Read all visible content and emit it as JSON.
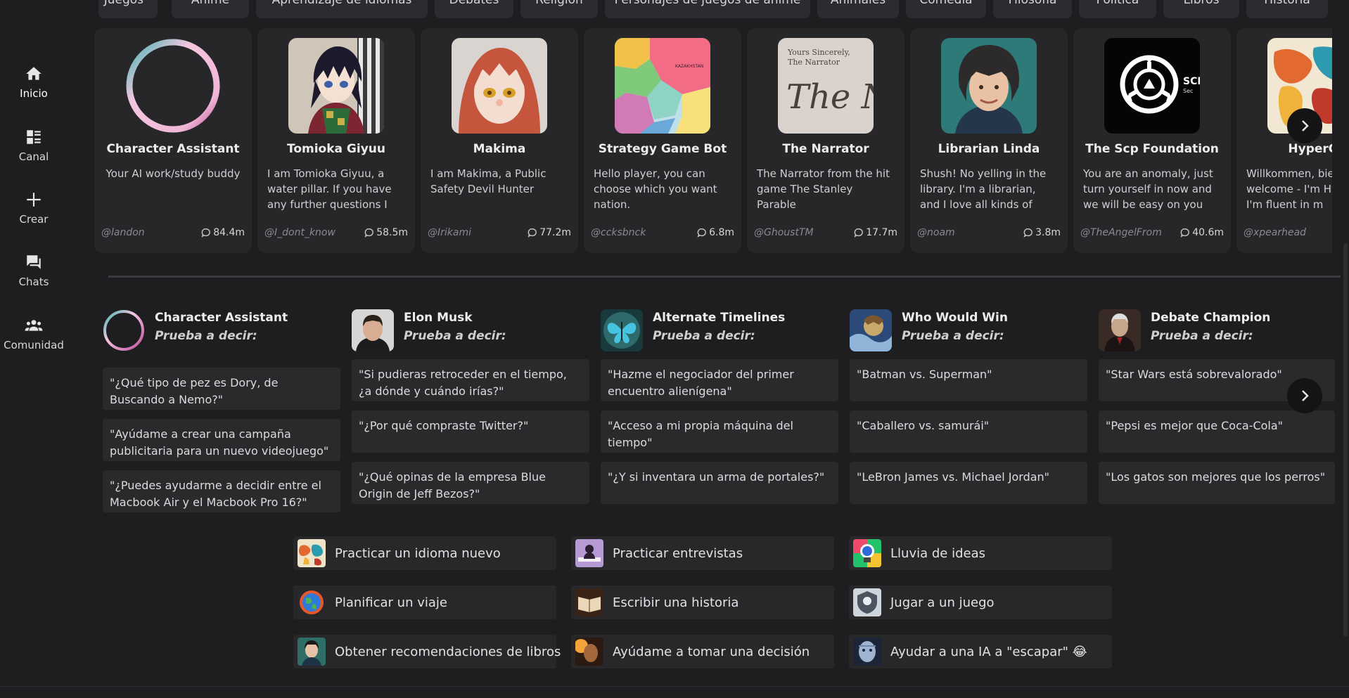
{
  "sidebar": {
    "items": [
      {
        "label": "Inicio",
        "icon": "home-icon"
      },
      {
        "label": "Canal",
        "icon": "feed-icon"
      },
      {
        "label": "Crear",
        "icon": "plus-icon"
      },
      {
        "label": "Chats",
        "icon": "chat-icon"
      },
      {
        "label": "Comunidad",
        "icon": "community-icon"
      }
    ]
  },
  "categories": [
    "Juegos",
    "Anime",
    "Aprendizaje de idiomas",
    "Debates",
    "Religión",
    "Personajes de juegos de anime",
    "Animales",
    "Comedia",
    "Filosofía",
    "Política",
    "Libros",
    "Historia"
  ],
  "characters": [
    {
      "name": "Character Assistant",
      "desc": "Your AI work/study buddy",
      "author": "@landon",
      "count": "84.4m"
    },
    {
      "name": "Tomioka Giyuu",
      "desc": "I am Tomioka Giyuu, a water pillar. If you have any further questions I don't…",
      "author": "@I_dont_know",
      "count": "58.5m"
    },
    {
      "name": "Makima",
      "desc": "I am Makima, a Public Safety Devil Hunter",
      "author": "@Irikami",
      "count": "77.2m"
    },
    {
      "name": "Strategy Game Bot",
      "desc": "Hello player, you can choose which you want nation.",
      "author": "@ccksbnck",
      "count": "6.8m"
    },
    {
      "name": "The Narrator",
      "desc": "The Narrator from the hit game The Stanley Parable",
      "author": "@GhoustTM",
      "count": "17.7m"
    },
    {
      "name": "Librarian Linda",
      "desc": "Shush! No yelling in the library. I'm a librarian, and I love all kinds of books, an…",
      "author": "@noam",
      "count": "3.8m"
    },
    {
      "name": "The Scp Foundation",
      "desc": "You are an anomaly, just turn yourself in now and we will be easy on you",
      "author": "@TheAngelFrom",
      "count": "40.6m"
    },
    {
      "name": "HyperGl",
      "desc": "Willkommen, bien welcome - I'm Hyp and I'm fluent in m",
      "author": "@xpearhead",
      "count": ""
    }
  ],
  "narrator_thumb": {
    "line1": "Yours Sincerely,",
    "line2": "The Narrator",
    "script": "The Na"
  },
  "scp_thumb": {
    "text": "SCI",
    "sub": "Sec"
  },
  "map_thumb": {
    "text": "KAZAKHSTAN"
  },
  "try_saying": {
    "subtitle": "Prueba a decir:",
    "columns": [
      {
        "name": "Character Assistant",
        "prompts": [
          "\"¿Qué tipo de pez es Dory, de Buscando a Nemo?\"",
          "\"Ayúdame a crear una campaña publicitaria para un nuevo videojuego\"",
          "\"¿Puedes ayudarme a decidir entre el Macbook Air y el Macbook Pro 16?\""
        ]
      },
      {
        "name": "Elon Musk",
        "prompts": [
          "\"Si pudieras retroceder en el tiempo, ¿a dónde y cuándo irías?\"",
          "\"¿Por qué compraste Twitter?\"",
          "\"¿Qué opinas de la empresa Blue Origin de Jeff Bezos?\""
        ]
      },
      {
        "name": "Alternate Timelines",
        "prompts": [
          "\"Hazme el negociador del primer encuentro alienígena\"",
          "\"Acceso a mi propia máquina del tiempo\"",
          "\"¿Y si inventara un arma de portales?\""
        ]
      },
      {
        "name": "Who Would Win",
        "prompts": [
          "\"Batman vs. Superman\"",
          "\"Caballero vs. samurái\"",
          "\"LeBron James vs. Michael Jordan\""
        ]
      },
      {
        "name": "Debate Champion",
        "prompts": [
          "\"Star Wars está sobrevalorado\"",
          "\"Pepsi es mejor que Coca-Cola\"",
          "\"Los gatos son mejores que los perros\""
        ]
      }
    ]
  },
  "suggestions": [
    {
      "label": "Practicar un idioma nuevo",
      "icon": "world-map-icon"
    },
    {
      "label": "Practicar entrevistas",
      "icon": "interview-icon"
    },
    {
      "label": "Lluvia de ideas",
      "icon": "lightbulb-icon"
    },
    {
      "label": "Planificar un viaje",
      "icon": "globe-icon"
    },
    {
      "label": "Escribir una historia",
      "icon": "book-icon"
    },
    {
      "label": "Jugar a un juego",
      "icon": "game-shield-icon"
    },
    {
      "label": "Obtener recomendaciones de libros",
      "icon": "reader-icon"
    },
    {
      "label": "Ayúdame a tomar una decisión",
      "icon": "thinker-icon"
    },
    {
      "label": "Ayudar a una IA a \"escapar\" 😂",
      "icon": "robot-face-icon"
    }
  ],
  "colors": {
    "background": "#1e1e20",
    "card": "#27272a",
    "ring_pink": "#e9a6cd",
    "ring_teal": "#3fb5b0"
  }
}
